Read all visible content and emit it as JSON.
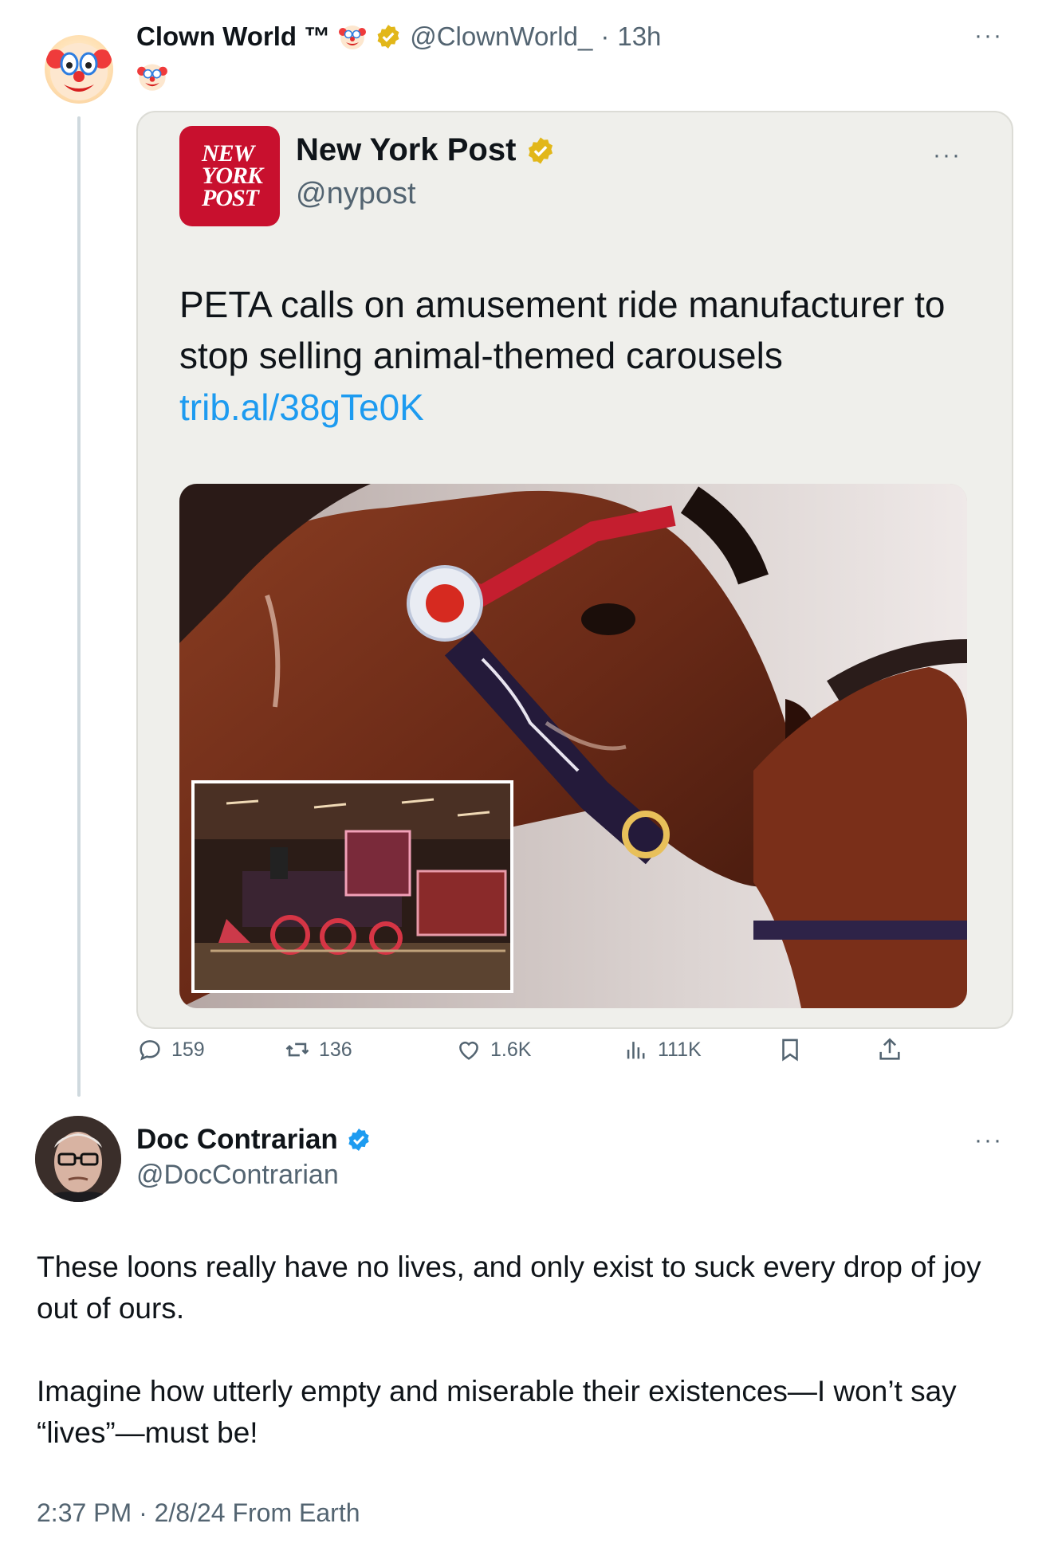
{
  "tweet": {
    "author_name": "Clown World ™",
    "name_emoji": "clown-face-emoji",
    "verified": "gold",
    "handle": "@ClownWorld_",
    "time": "13h",
    "body_emoji": "clown-face-emoji",
    "more_label": "···"
  },
  "quoted": {
    "logo_lines": [
      "NEW",
      "YORK",
      "POST"
    ],
    "name": "New York Post",
    "verified": "gold",
    "handle": "@nypost",
    "more_label": "···",
    "text": "PETA calls on amusement ride manufacturer to stop selling animal-themed carousels",
    "link": "trib.al/38gTe0K",
    "media": {
      "main": "carousel-horse-photo",
      "inset": "carousel-train-photo"
    }
  },
  "actions": {
    "replies": "159",
    "retweets": "136",
    "likes": "1.6K",
    "views": "111K"
  },
  "reply": {
    "author_name": "Doc Contrarian",
    "verified": "blue",
    "handle": "@DocContrarian",
    "more_label": "···",
    "paragraphs": [
      "These loons really have no lives, and only exist to suck every drop of joy out of ours.",
      "Imagine how utterly empty and miserable their existences—I won’t say “lives”—must be!"
    ],
    "timestamp": "2:37 PM · 2/8/24 From Earth"
  },
  "colors": {
    "text": "#0f1419",
    "muted": "#536471",
    "link": "#1d9bf0",
    "nyp_red": "#c8102e",
    "card_bg": "#efefeb",
    "gold_badge": "#e2b719",
    "blue_badge": "#1d9bf0"
  }
}
